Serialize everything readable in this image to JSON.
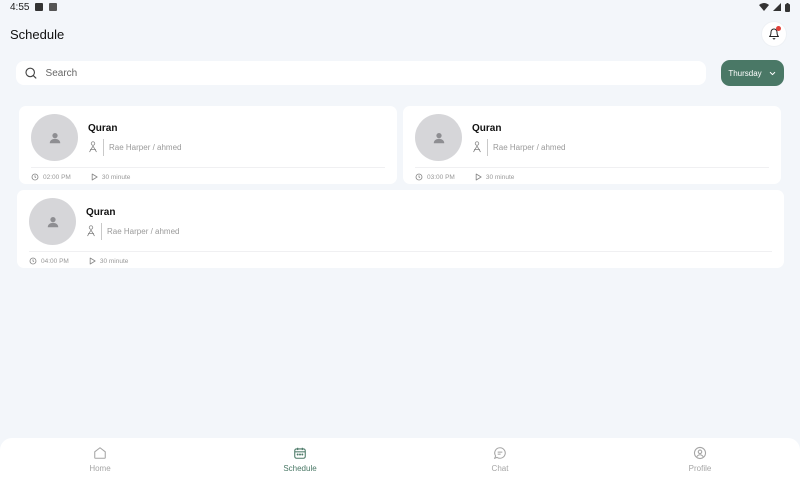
{
  "status_bar": {
    "time": "4:55"
  },
  "header": {
    "title": "Schedule"
  },
  "search": {
    "placeholder": "Search"
  },
  "day_filter": {
    "selected": "Thursday"
  },
  "sessions": [
    {
      "subject": "Quran",
      "participants": "Rae Harper / ahmed",
      "time": "02:00 PM",
      "duration": "30 minute"
    },
    {
      "subject": "Quran",
      "participants": "Rae Harper / ahmed",
      "time": "03:00 PM",
      "duration": "30 minute"
    },
    {
      "subject": "Quran",
      "participants": "Rae Harper / ahmed",
      "time": "04:00 PM",
      "duration": "30 minute"
    }
  ],
  "nav": {
    "items": [
      {
        "label": "Home",
        "icon": "home-icon",
        "active": false
      },
      {
        "label": "Schedule",
        "icon": "calendar-icon",
        "active": true
      },
      {
        "label": "Chat",
        "icon": "chat-icon",
        "active": false
      },
      {
        "label": "Profile",
        "icon": "profile-icon",
        "active": false
      }
    ]
  },
  "colors": {
    "accent": "#4a7866",
    "background": "#f3f6fa",
    "notification": "#e0413a"
  }
}
